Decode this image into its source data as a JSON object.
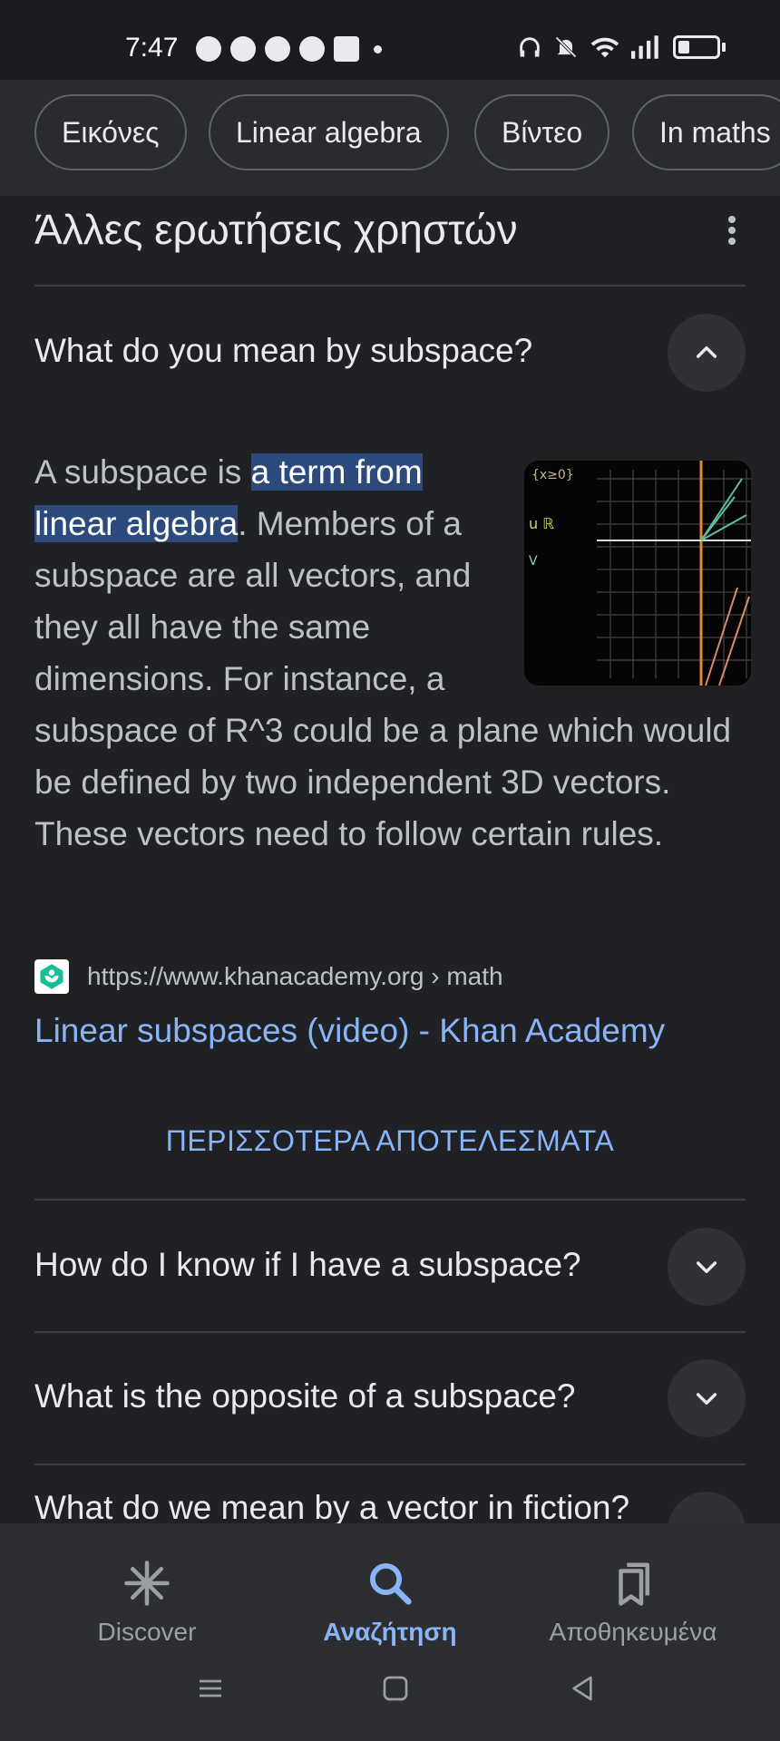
{
  "status_bar": {
    "time": "7:47"
  },
  "chips": [
    "Εικόνες",
    "Linear algebra",
    "Βίντεο",
    "In maths"
  ],
  "section": {
    "title": "Άλλες ερωτήσεις χρηστών"
  },
  "faq": {
    "expanded_question": "What do you mean by subspace?",
    "answer": {
      "before": "A subspace is ",
      "highlight": "a term from linear algebra",
      "after": ". Members of a subspace are all vectors, and they all have the same dimensions. For instance, a subspace of R^3 could be a plane which would be defined by two independent 3D vectors. These vectors need to follow certain rules."
    },
    "source": {
      "url": "https://www.khanacademy.org › math",
      "title": "Linear subspaces (video) - Khan Academy"
    },
    "more_results": "ΠΕΡΙΣΣΟΤΕΡΑ ΑΠΟΤΕΛΕΣΜΑΤΑ",
    "collapsed_questions": [
      "How do I know if I have a subspace?",
      "What is the opposite of a subspace?",
      "What do we mean by a vector in fiction?"
    ]
  },
  "bottom_nav": {
    "items": [
      {
        "label": "Discover",
        "icon": "asterisk-icon"
      },
      {
        "label": "Αναζήτηση",
        "icon": "search-icon"
      },
      {
        "label": "Αποθηκευμένα",
        "icon": "bookmarks-icon"
      }
    ],
    "active": "Αναζήτηση"
  },
  "colors": {
    "background": "#202124",
    "accent": "#8ab4f8",
    "highlight": "#2c4a7c"
  }
}
